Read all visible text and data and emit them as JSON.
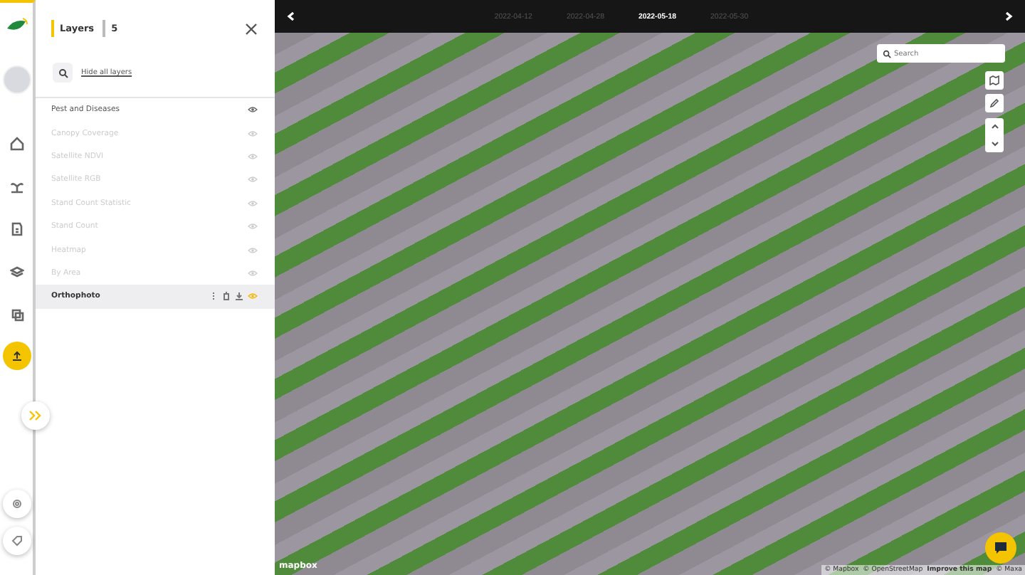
{
  "panel": {
    "title": "Layers",
    "count": "5",
    "hide_all": "Hide all layers"
  },
  "layers": [
    {
      "name": "Pest and Diseases",
      "visible": true,
      "selected": false
    },
    {
      "name": "Canopy Coverage",
      "visible": false,
      "selected": false
    },
    {
      "name": "Satellite NDVI",
      "visible": false,
      "selected": false
    },
    {
      "name": "Satellite RGB",
      "visible": false,
      "selected": false
    },
    {
      "name": "Stand Count Statistic",
      "visible": false,
      "selected": false
    },
    {
      "name": "Stand Count",
      "visible": false,
      "selected": false
    },
    {
      "name": "Heatmap",
      "visible": false,
      "selected": false
    },
    {
      "name": "By Area",
      "visible": false,
      "selected": false
    },
    {
      "name": "Orthophoto",
      "visible": true,
      "selected": true
    }
  ],
  "dates": [
    {
      "label": "2022-04-12",
      "selected": false
    },
    {
      "label": "2022-04-28",
      "selected": false
    },
    {
      "label": "2022-05-18",
      "selected": true
    },
    {
      "label": "2022-05-30",
      "selected": false
    }
  ],
  "map": {
    "search": {
      "placeholder": "Search"
    },
    "logo": "mapbox",
    "attribution": [
      {
        "text": "© Mapbox",
        "bold": false
      },
      {
        "text": "© OpenStreetMap",
        "bold": false
      },
      {
        "text": "Improve this map",
        "bold": true
      },
      {
        "text": "© Maxa",
        "bold": false
      }
    ]
  }
}
